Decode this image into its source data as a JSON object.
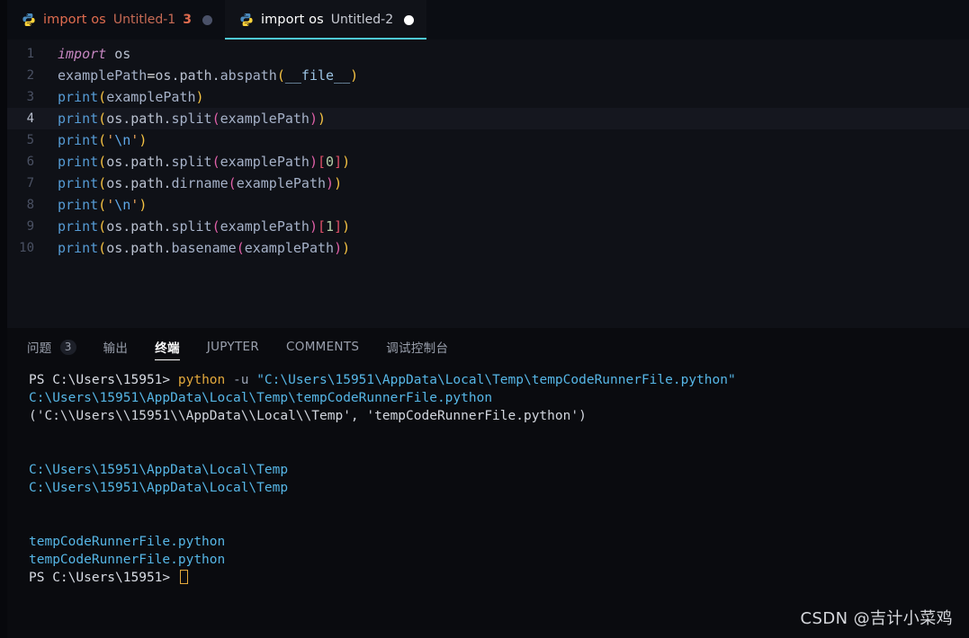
{
  "window": {
    "theme": "dark",
    "colors": {
      "editor_bg": "#0f1117",
      "tabbar_bg": "#0b0d13",
      "active_tab_bg": "#101218",
      "panel_bg": "#0a0b0f",
      "active_tab_underline": "#4ec9d4",
      "modified_tab_text": "#e06c4f",
      "cursor": "#e3a93c",
      "terminal_path": "#56b6e6",
      "terminal_command": "#e3a93c"
    }
  },
  "tabbar": {
    "tabs": [
      {
        "icon": "python-file-icon",
        "title_keyword": "import",
        "title_module": "os",
        "filename": "Untitled-1",
        "badge": "3",
        "state": "inactive",
        "modified": true,
        "dot": "dim"
      },
      {
        "icon": "python-file-icon",
        "title_keyword": "import",
        "title_module": "os",
        "filename": "Untitled-2",
        "badge": "",
        "state": "active",
        "modified": true,
        "dot": "white"
      }
    ]
  },
  "editor": {
    "language": "python",
    "active_line": 4,
    "lines": [
      {
        "n": "1",
        "text": "import os"
      },
      {
        "n": "2",
        "text": "examplePath=os.path.abspath(__file__)"
      },
      {
        "n": "3",
        "text": "print(examplePath)"
      },
      {
        "n": "4",
        "text": "print(os.path.split(examplePath))"
      },
      {
        "n": "5",
        "text": "print('\\n')"
      },
      {
        "n": "6",
        "text": "print(os.path.split(examplePath)[0])"
      },
      {
        "n": "7",
        "text": "print(os.path.dirname(examplePath))"
      },
      {
        "n": "8",
        "text": "print('\\n')"
      },
      {
        "n": "9",
        "text": "print(os.path.split(examplePath)[1])"
      },
      {
        "n": "10",
        "text": "print(os.path.basename(examplePath))"
      }
    ]
  },
  "panel": {
    "tabs": [
      {
        "label": "问题",
        "count": "3",
        "active": false
      },
      {
        "label": "输出",
        "count": "",
        "active": false
      },
      {
        "label": "终端",
        "count": "",
        "active": true
      },
      {
        "label": "JUPYTER",
        "count": "",
        "active": false
      },
      {
        "label": "COMMENTS",
        "count": "",
        "active": false
      },
      {
        "label": "调试控制台",
        "count": "",
        "active": false
      }
    ],
    "terminal": {
      "prompt": "PS C:\\Users\\15951> ",
      "command": "python",
      "flag": " -u ",
      "command_arg": "\"C:\\Users\\15951\\AppData\\Local\\Temp\\tempCodeRunnerFile.python\"",
      "output_lines": [
        "C:\\Users\\15951\\AppData\\Local\\Temp\\tempCodeRunnerFile.python",
        "('C:\\\\Users\\\\15951\\\\AppData\\\\Local\\\\Temp', 'tempCodeRunnerFile.python')",
        "",
        "",
        "C:\\Users\\15951\\AppData\\Local\\Temp",
        "C:\\Users\\15951\\AppData\\Local\\Temp",
        "",
        "",
        "tempCodeRunnerFile.python",
        "tempCodeRunnerFile.python"
      ],
      "final_prompt": "PS C:\\Users\\15951> ",
      "cursor_visible": true
    }
  },
  "watermark": {
    "text": "CSDN @吉计小菜鸡"
  }
}
